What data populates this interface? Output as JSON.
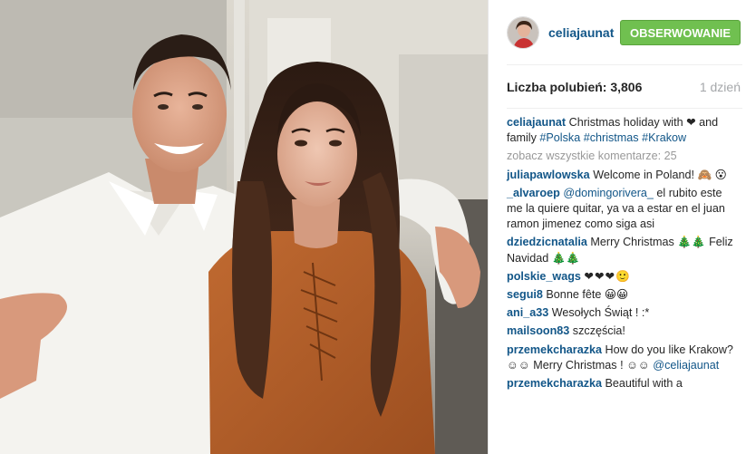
{
  "post": {
    "username": "celiajaunat",
    "follow_label": "OBSERWOWANIE",
    "likes_label": "Liczba polubień: 3,806",
    "time_ago": "1 dzień",
    "caption": {
      "user": "celiajaunat",
      "text": "Christmas holiday with ",
      "heart": "❤",
      "text2": " and family ",
      "tags": [
        "#Polska",
        "#christmas",
        "#Krakow"
      ]
    },
    "view_all": "zobacz wszystkie komentarze: 25",
    "comments": [
      {
        "user": "juliapawlowska",
        "text": "Welcome in Poland! 🙈 😮"
      },
      {
        "user": "_alvaroep",
        "mention": "@domingorivera_",
        "text": " el rubito este me la quiere quitar, ya va a estar en el juan ramon jimenez como siga asi"
      },
      {
        "user": "dziedzicnatalia",
        "text": "Merry Christmas 🎄🎄 Feliz Navidad 🎄🎄"
      },
      {
        "user": "polskie_wags",
        "text": "❤❤❤🙂"
      },
      {
        "user": "segui8",
        "text": "Bonne fête 😀😀"
      },
      {
        "user": "ani_a33",
        "text": "Wesołych Świąt ! :*"
      },
      {
        "user": "mailsoon83",
        "text": "szczęścia!"
      },
      {
        "user": "przemekcharazka",
        "text": "How do you like Krakow? ☺☺ Merry Christmas ! ☺☺",
        "mention": "@celiajaunat"
      },
      {
        "user": "przemekcharazka",
        "text": "Beautiful with a"
      }
    ]
  },
  "colors": {
    "link": "#125688",
    "follow_bg": "#70c050",
    "sweater": "#b5602a",
    "hair": "#3b2418",
    "shirt": "#f4f3ef"
  },
  "icons": {
    "avatar": "profile-avatar"
  }
}
